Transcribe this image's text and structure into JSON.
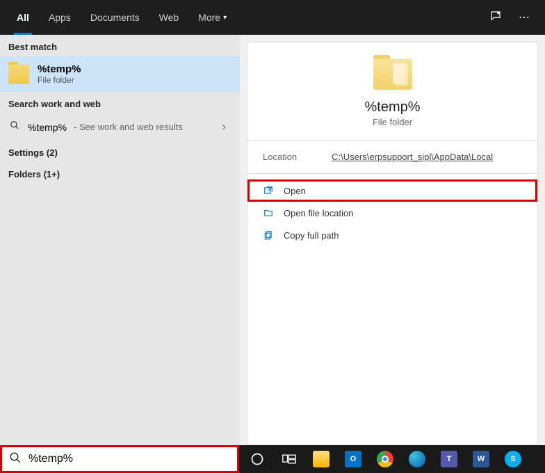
{
  "tabs": {
    "all": "All",
    "apps": "Apps",
    "documents": "Documents",
    "web": "Web",
    "more": "More"
  },
  "left": {
    "best_match_label": "Best match",
    "result": {
      "title": "%temp%",
      "subtitle": "File folder"
    },
    "search_web_label": "Search work and web",
    "web_result": {
      "term": "%temp%",
      "suffix": " - See work and web results"
    },
    "settings_label": "Settings (2)",
    "folders_label": "Folders (1+)"
  },
  "preview": {
    "title": "%temp%",
    "subtitle": "File folder",
    "location_label": "Location",
    "location_path": "C:\\Users\\erpsupport_sipl\\AppData\\Local",
    "actions": {
      "open": "Open",
      "open_location": "Open file location",
      "copy_path": "Copy full path"
    }
  },
  "search": {
    "value": "%temp%"
  }
}
